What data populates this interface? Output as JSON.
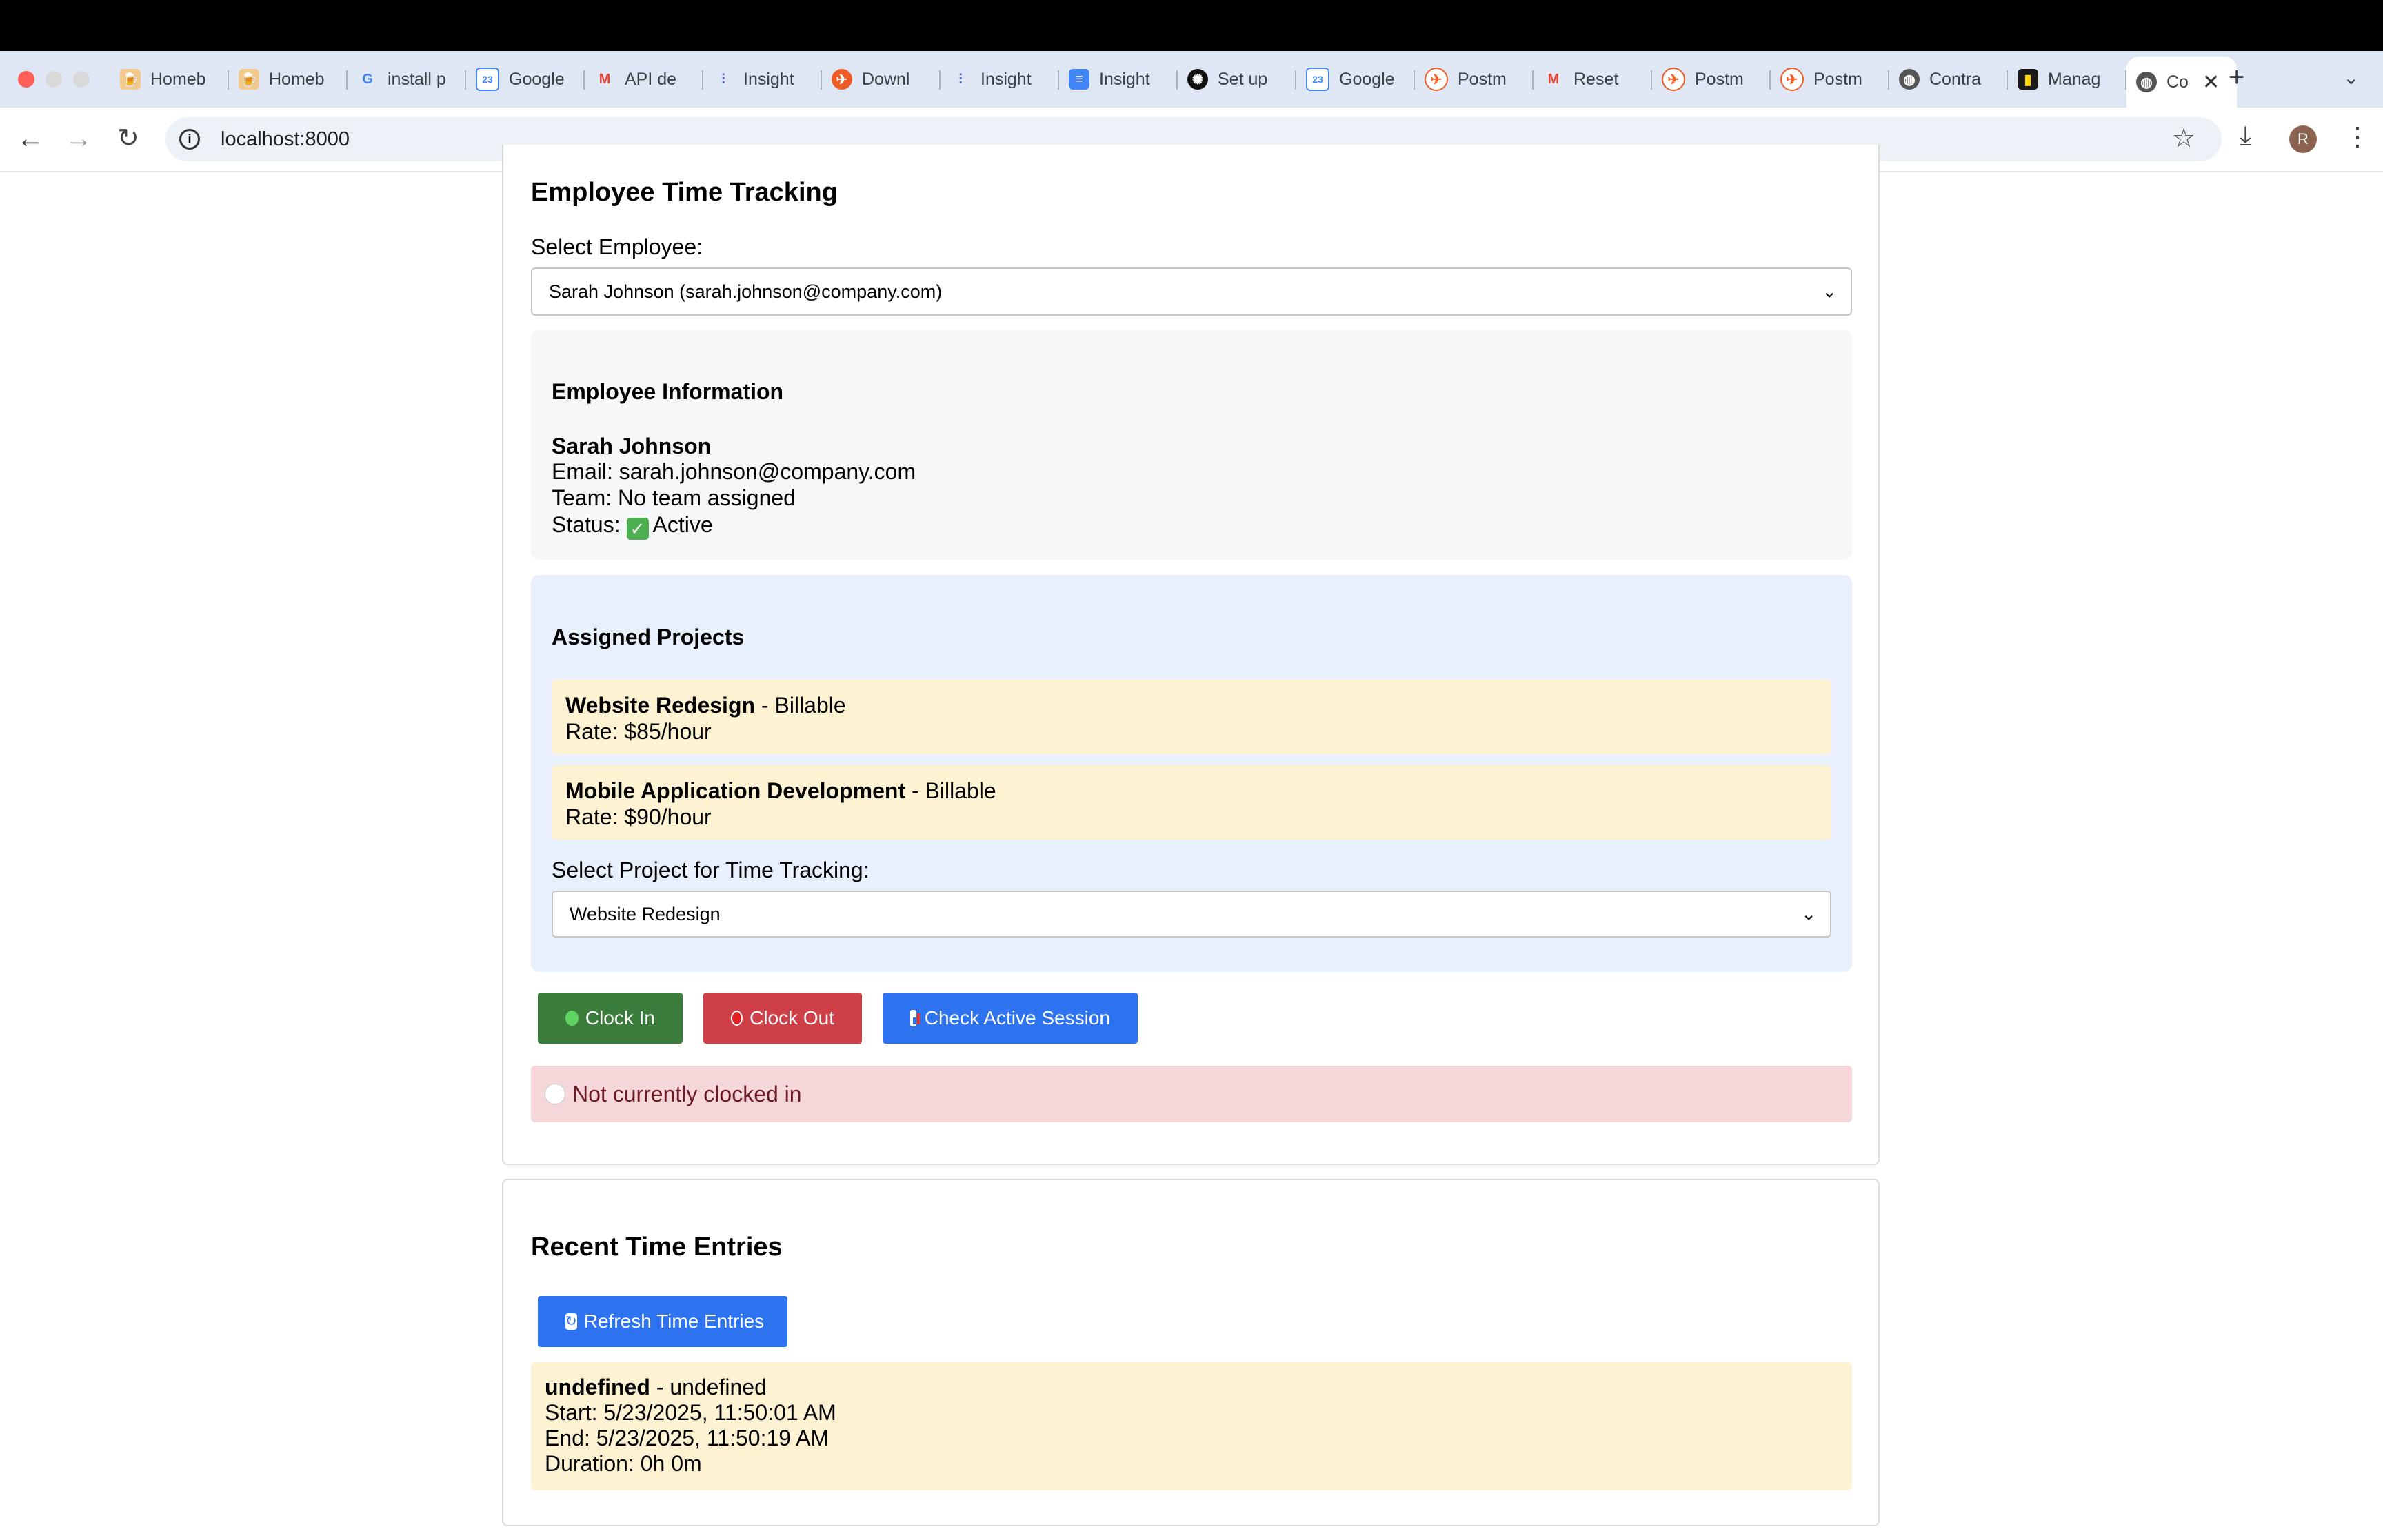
{
  "browser": {
    "tabs": [
      {
        "label": "Homeb",
        "icon": "homebrew-icon"
      },
      {
        "label": "Homeb",
        "icon": "homebrew-icon"
      },
      {
        "label": "install p",
        "icon": "google-icon"
      },
      {
        "label": "Google",
        "icon": "google-calendar-icon"
      },
      {
        "label": "API de",
        "icon": "gmail-icon"
      },
      {
        "label": "Insight",
        "icon": "insightful-icon"
      },
      {
        "label": "Downl",
        "icon": "postman-icon"
      },
      {
        "label": "Insight",
        "icon": "insightful-icon"
      },
      {
        "label": "Insight",
        "icon": "google-docs-icon"
      },
      {
        "label": "Set up",
        "icon": "openai-icon"
      },
      {
        "label": "Google",
        "icon": "google-calendar-icon"
      },
      {
        "label": "Postm",
        "icon": "postman-icon"
      },
      {
        "label": "Reset",
        "icon": "gmail-icon"
      },
      {
        "label": "Postm",
        "icon": "postman-icon"
      },
      {
        "label": "Postm",
        "icon": "postman-icon"
      },
      {
        "label": "Contra",
        "icon": "globe-icon"
      },
      {
        "label": "Manag",
        "icon": "app-icon"
      }
    ],
    "active_tab": {
      "label": "Co",
      "icon": "globe-icon"
    },
    "url": "localhost:8000",
    "avatar_initial": "R"
  },
  "tracking": {
    "title": "Employee Time Tracking",
    "select_employee_label": "Select Employee:",
    "selected_employee": "Sarah Johnson (sarah.johnson@company.com)",
    "info": {
      "heading": "Employee Information",
      "name": "Sarah Johnson",
      "email_line": "Email: sarah.johnson@company.com",
      "team_line": "Team: No team assigned",
      "status_prefix": "Status: ",
      "status_value": "Active"
    },
    "projects": {
      "heading": "Assigned Projects",
      "items": [
        {
          "name": "Website Redesign",
          "type": " - Billable",
          "rate": "Rate: $85/hour"
        },
        {
          "name": "Mobile Application Development",
          "type": " - Billable",
          "rate": "Rate: $90/hour"
        }
      ],
      "select_label": "Select Project for Time Tracking:",
      "selected_project": "Website Redesign"
    },
    "buttons": {
      "clock_in": "Clock In",
      "clock_out": "Clock Out",
      "check_session": "Check Active Session"
    },
    "status_message": "Not currently clocked in"
  },
  "recent": {
    "title": "Recent Time Entries",
    "refresh_label": "Refresh Time Entries",
    "entries": [
      {
        "project": "undefined",
        "description": " - undefined",
        "start": "Start: 5/23/2025, 11:50:01 AM",
        "end": "End: 5/23/2025, 11:50:19 AM",
        "duration": "Duration: 0h 0m"
      }
    ]
  },
  "colors": {
    "clock_in": "#3a7d3a",
    "clock_out": "#cf3f47",
    "primary_blue": "#2d73f0",
    "status_bg": "#f5d7da",
    "project_bg": "#fdf2d1"
  }
}
